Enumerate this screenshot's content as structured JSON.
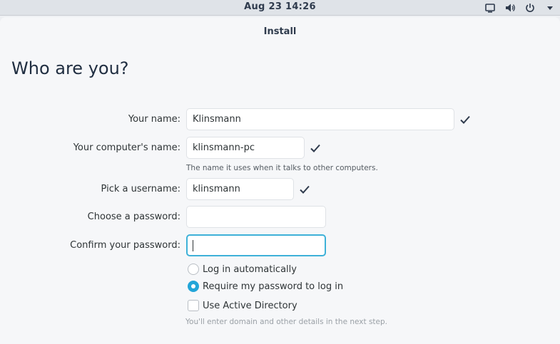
{
  "panel": {
    "clock": "Aug 23  14:26",
    "tray_icons": [
      "display-icon",
      "volume-icon",
      "power-icon",
      "menu-arrow-icon"
    ]
  },
  "window": {
    "title": "Install"
  },
  "page": {
    "title": "Who are you?"
  },
  "form": {
    "name": {
      "label": "Your name:",
      "value": "Klinsmann",
      "valid": true
    },
    "computer": {
      "label": "Your computer's name:",
      "value": "klinsmann-pc",
      "valid": true,
      "hint": "The name it uses when it talks to other computers."
    },
    "username": {
      "label": "Pick a username:",
      "value": "klinsmann",
      "valid": true
    },
    "password": {
      "label": "Choose a password:",
      "value": ""
    },
    "confirm": {
      "label": "Confirm your password:",
      "value": ""
    }
  },
  "login_options": [
    {
      "label": "Log in automatically",
      "selected": false
    },
    {
      "label": "Require my password to log in",
      "selected": true
    }
  ],
  "active_directory": {
    "label": "Use Active Directory",
    "checked": false,
    "hint": "You'll enter domain and other details in the next step."
  },
  "colors": {
    "accent": "#3eb1d8",
    "radio_selected": "#22a5d8",
    "check": "#2f3b4d"
  }
}
